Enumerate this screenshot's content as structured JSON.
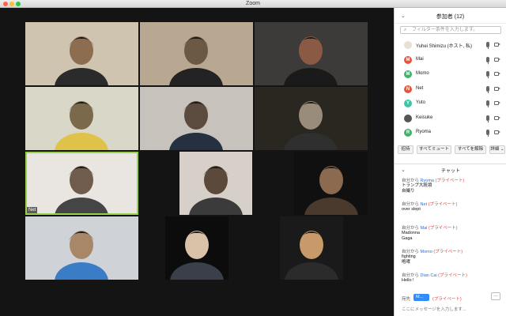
{
  "window": {
    "title": "Zoom"
  },
  "video_tiles": [
    {
      "name": ""
    },
    {
      "name": ""
    },
    {
      "name": ""
    },
    {
      "name": ""
    },
    {
      "name": ""
    },
    {
      "name": ""
    },
    {
      "name": "Net",
      "active": true
    },
    {
      "name": ""
    },
    {
      "name": ""
    },
    {
      "name": ""
    },
    {
      "name": ""
    },
    {
      "name": ""
    }
  ],
  "participants": {
    "title": "参加者 (12)",
    "filter_placeholder": "フィルター条件を入力します。",
    "list": [
      {
        "name": "Yuhei Shimizu (ホスト, 私)",
        "initial": "",
        "color": "#e9e0d5",
        "mic": true,
        "video": true
      },
      {
        "name": "Mai",
        "initial": "M",
        "color": "#e8553f",
        "mic": true,
        "video": true
      },
      {
        "name": "Momo",
        "initial": "M",
        "color": "#3fb36b",
        "mic": true,
        "video": true
      },
      {
        "name": "Net",
        "initial": "N",
        "color": "#e8553f",
        "mic": true,
        "video": true
      },
      {
        "name": "Yuto",
        "initial": "Y",
        "color": "#3fc4a6",
        "mic": true,
        "video": true
      },
      {
        "name": "Keisuke",
        "initial": "",
        "color": "#555555",
        "mic": true,
        "video": true
      },
      {
        "name": "Ryoma",
        "initial": "R",
        "color": "#3fb36b",
        "mic": true,
        "video": true
      }
    ],
    "buttons": {
      "invite": "招待",
      "mute_all": "すべてミュート",
      "unmute_all": "すべてを解除",
      "more": "詳細 ⌄"
    }
  },
  "chat": {
    "title": "チャット",
    "messages": [
      {
        "from": "自分から",
        "to": "Ryoma",
        "tag": "(プライベート)",
        "text": "トランプ大統領\n自撮り"
      },
      {
        "from": "自分から",
        "to": "Net",
        "tag": "(プライベート)",
        "text": "over slept"
      },
      {
        "from": "自分から",
        "to": "Mai",
        "tag": "(プライベート)",
        "text": "Madonna\nGaga"
      },
      {
        "from": "自分から",
        "to": "Momo",
        "tag": "(プライベート)",
        "text": "fighting\n咆哮"
      },
      {
        "from": "自分から",
        "to": "Dian Cai",
        "tag": "(プライベート)",
        "text": "Hello !"
      }
    ],
    "to_label": "宛先",
    "to_value": "M...",
    "to_private": "(プライベート)",
    "more_label": "…",
    "input_placeholder": "ここにメッセージを入力します..."
  },
  "colors": {
    "accent": "#2d8cff",
    "private": "#e0413a",
    "active_speaker": "#9ad04b"
  }
}
